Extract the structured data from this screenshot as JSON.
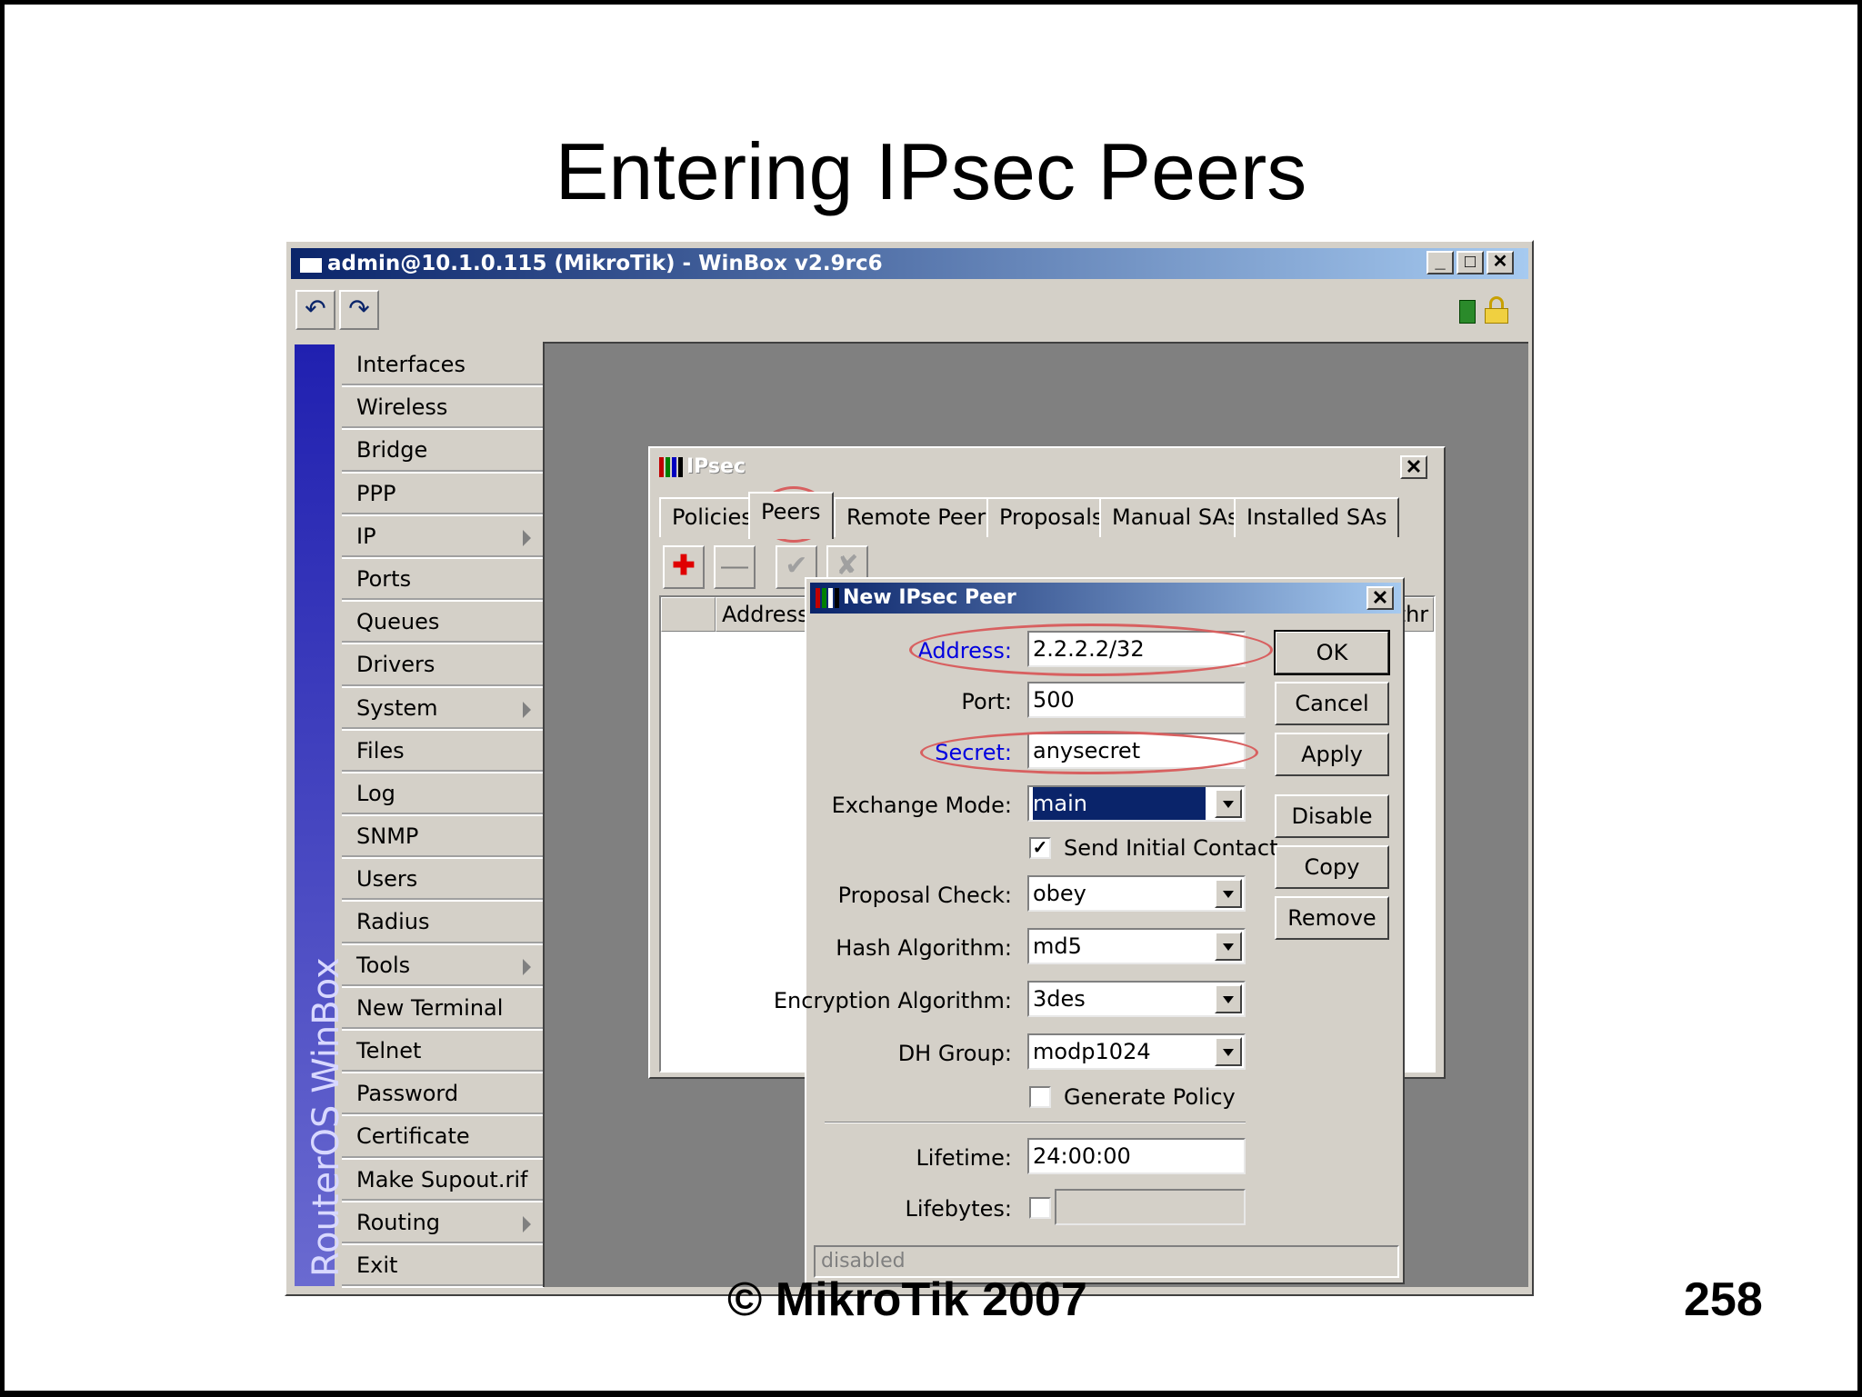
{
  "slide": {
    "title": "Entering IPsec Peers",
    "footer": "© MikroTik 2007",
    "page_number": "258"
  },
  "winbox": {
    "title": "admin@10.1.0.115 (MikroTik) - WinBox v2.9rc6",
    "brand": "RouterOS WinBox",
    "menu": [
      {
        "label": "Interfaces"
      },
      {
        "label": "Wireless"
      },
      {
        "label": "Bridge"
      },
      {
        "label": "PPP"
      },
      {
        "label": "IP",
        "submenu": true
      },
      {
        "label": "Ports"
      },
      {
        "label": "Queues"
      },
      {
        "label": "Drivers"
      },
      {
        "label": "System",
        "submenu": true
      },
      {
        "label": "Files"
      },
      {
        "label": "Log"
      },
      {
        "label": "SNMP"
      },
      {
        "label": "Users"
      },
      {
        "label": "Radius"
      },
      {
        "label": "Tools",
        "submenu": true
      },
      {
        "label": "New Terminal"
      },
      {
        "label": "Telnet"
      },
      {
        "label": "Password"
      },
      {
        "label": "Certificate"
      },
      {
        "label": "Make Supout.rif"
      },
      {
        "label": "Routing",
        "submenu": true
      },
      {
        "label": "Exit"
      }
    ]
  },
  "ipsec": {
    "title": "IPsec",
    "tabs": [
      "Policies",
      "Peers",
      "Remote Peers",
      "Proposals",
      "Manual SAs",
      "Installed SAs"
    ],
    "active_tab": "Peers",
    "columns": [
      "Address",
      "ithr"
    ]
  },
  "peer_dialog": {
    "title": "New IPsec Peer",
    "fields": {
      "address": {
        "label": "Address:",
        "value": "2.2.2.2/32"
      },
      "port": {
        "label": "Port:",
        "value": "500"
      },
      "secret": {
        "label": "Secret:",
        "value": "anysecret"
      },
      "exchange_mode": {
        "label": "Exchange Mode:",
        "value": "main"
      },
      "send_initial_contact": {
        "label": "Send Initial Contact",
        "checked": true
      },
      "proposal_check": {
        "label": "Proposal Check:",
        "value": "obey"
      },
      "hash_algorithm": {
        "label": "Hash Algorithm:",
        "value": "md5"
      },
      "encryption_algorithm": {
        "label": "Encryption Algorithm:",
        "value": "3des"
      },
      "dh_group": {
        "label": "DH Group:",
        "value": "modp1024"
      },
      "generate_policy": {
        "label": "Generate Policy",
        "checked": false
      },
      "lifetime": {
        "label": "Lifetime:",
        "value": "24:00:00"
      },
      "lifebytes": {
        "label": "Lifebytes:",
        "value": ""
      }
    },
    "buttons": {
      "ok": "OK",
      "cancel": "Cancel",
      "apply": "Apply",
      "disable": "Disable",
      "copy": "Copy",
      "remove": "Remove"
    },
    "status": "disabled"
  },
  "colors": {
    "titlebar": "#0a246a",
    "highlight_ring": "#d86060",
    "workspace": "#808080"
  }
}
